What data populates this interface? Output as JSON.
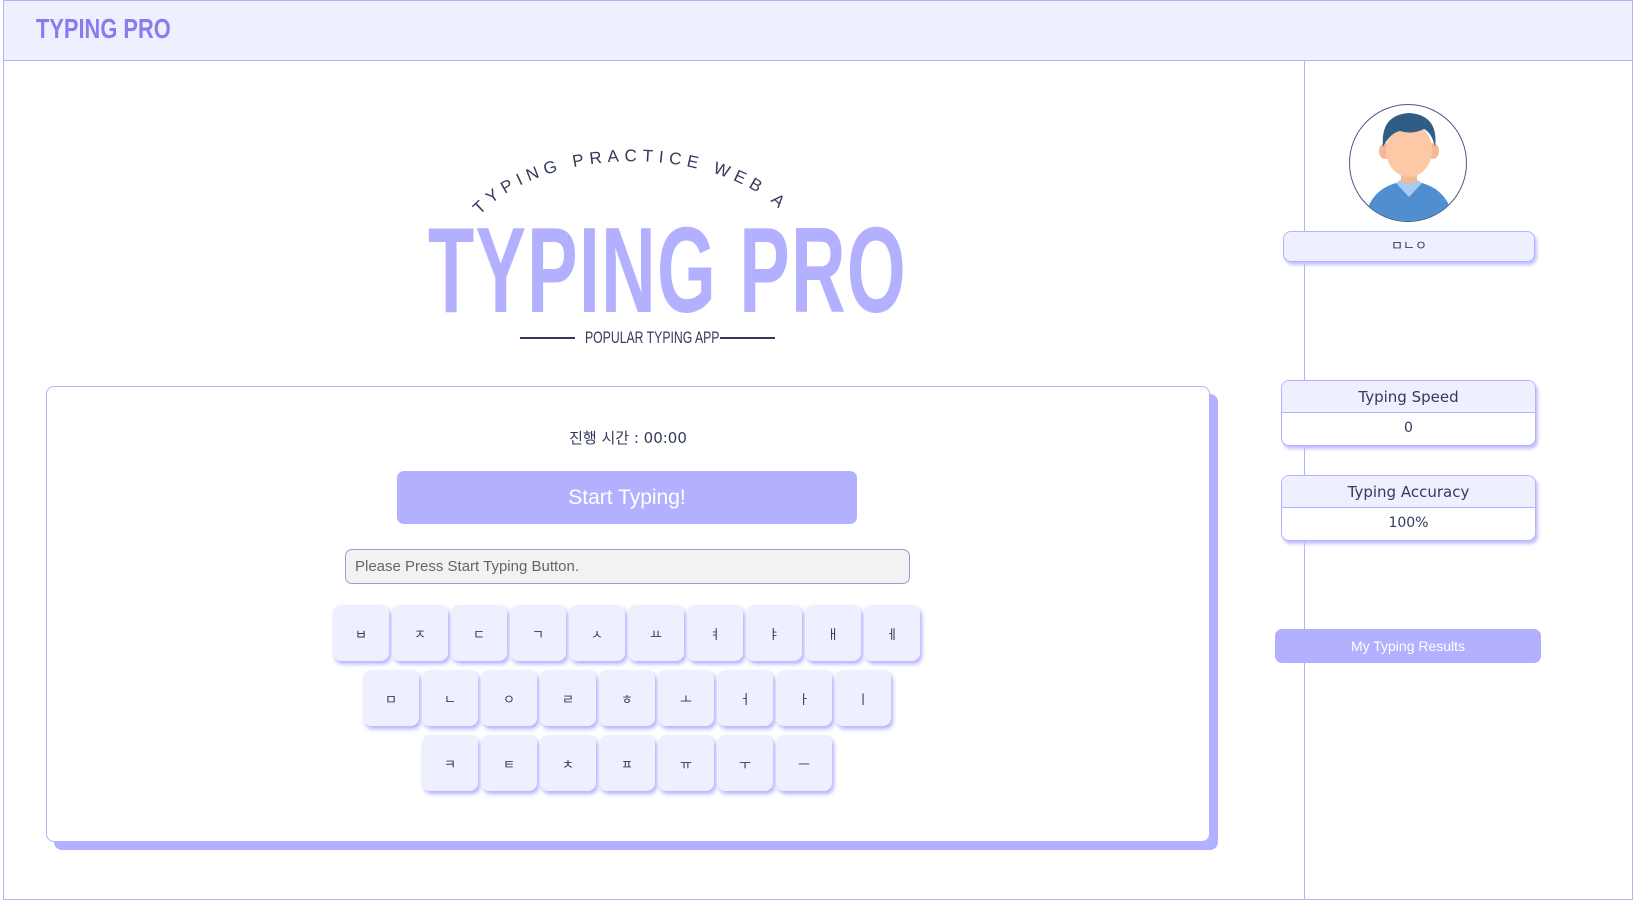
{
  "header": {
    "logo_text": "TYPING PRO"
  },
  "logo": {
    "arc_text": "TYPING PRACTICE WEB APPLICATION",
    "title": "TYPING PRO",
    "subtitle": "POPULAR TYPING APP"
  },
  "typing": {
    "timer_text": "진행 시간 : 00:00",
    "start_button_label": "Start Typing!",
    "input_placeholder": "Please Press Start Typing Button.",
    "input_value": ""
  },
  "keyboard": {
    "row1": [
      "ㅂ",
      "ㅈ",
      "ㄷ",
      "ㄱ",
      "ㅅ",
      "ㅛ",
      "ㅕ",
      "ㅑ",
      "ㅐ",
      "ㅔ"
    ],
    "row2": [
      "ㅁ",
      "ㄴ",
      "ㅇ",
      "ㄹ",
      "ㅎ",
      "ㅗ",
      "ㅓ",
      "ㅏ",
      "ㅣ"
    ],
    "row3": [
      "ㅋ",
      "ㅌ",
      "ㅊ",
      "ㅍ",
      "ㅠ",
      "ㅜ",
      "ㅡ"
    ]
  },
  "sidebar": {
    "user_name": "ㅁㄴㅇ",
    "typing_speed_label": "Typing Speed",
    "typing_speed_value": "0",
    "typing_accuracy_label": "Typing Accuracy",
    "typing_accuracy_value": "100%",
    "results_button_label": "My Typing Results"
  },
  "colors": {
    "accent": "#b3b0ff",
    "header_bg": "#eef0ff",
    "border": "#b3b3ff",
    "text": "#333a5c",
    "logo_purple": "#8a7cf0"
  }
}
